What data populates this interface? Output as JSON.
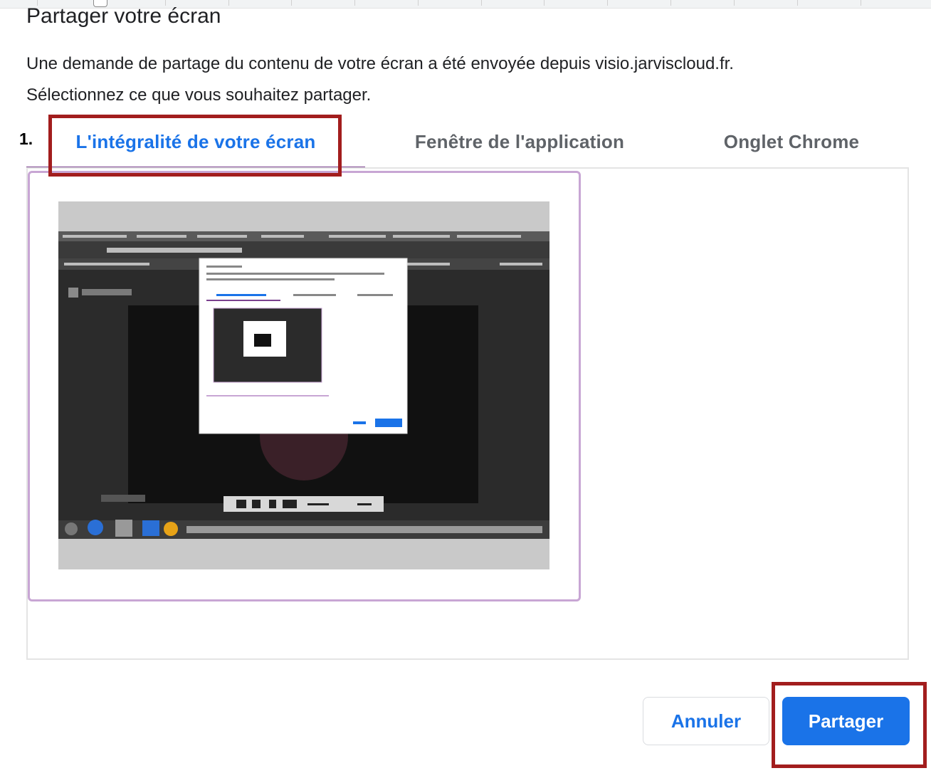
{
  "dialog": {
    "title": "Partager votre écran",
    "description_line1": "Une demande de partage du contenu de votre écran a été envoyée depuis visio.jarviscloud.fr.",
    "description_line2": "Sélectionnez ce que vous souhaitez partager."
  },
  "annotation": {
    "step_label": "1."
  },
  "tabs": [
    {
      "label": "L'intégralité de votre écran",
      "selected": true
    },
    {
      "label": "Fenêtre de l'application",
      "selected": false
    },
    {
      "label": "Onglet Chrome",
      "selected": false
    }
  ],
  "buttons": {
    "cancel_label": "Annuler",
    "share_label": "Partager"
  },
  "colors": {
    "accent": "#1a73e8",
    "tab_indicator": "#7a3f8e",
    "selected_card_border": "#c8a6d4",
    "annotation": "#a21d1d"
  }
}
